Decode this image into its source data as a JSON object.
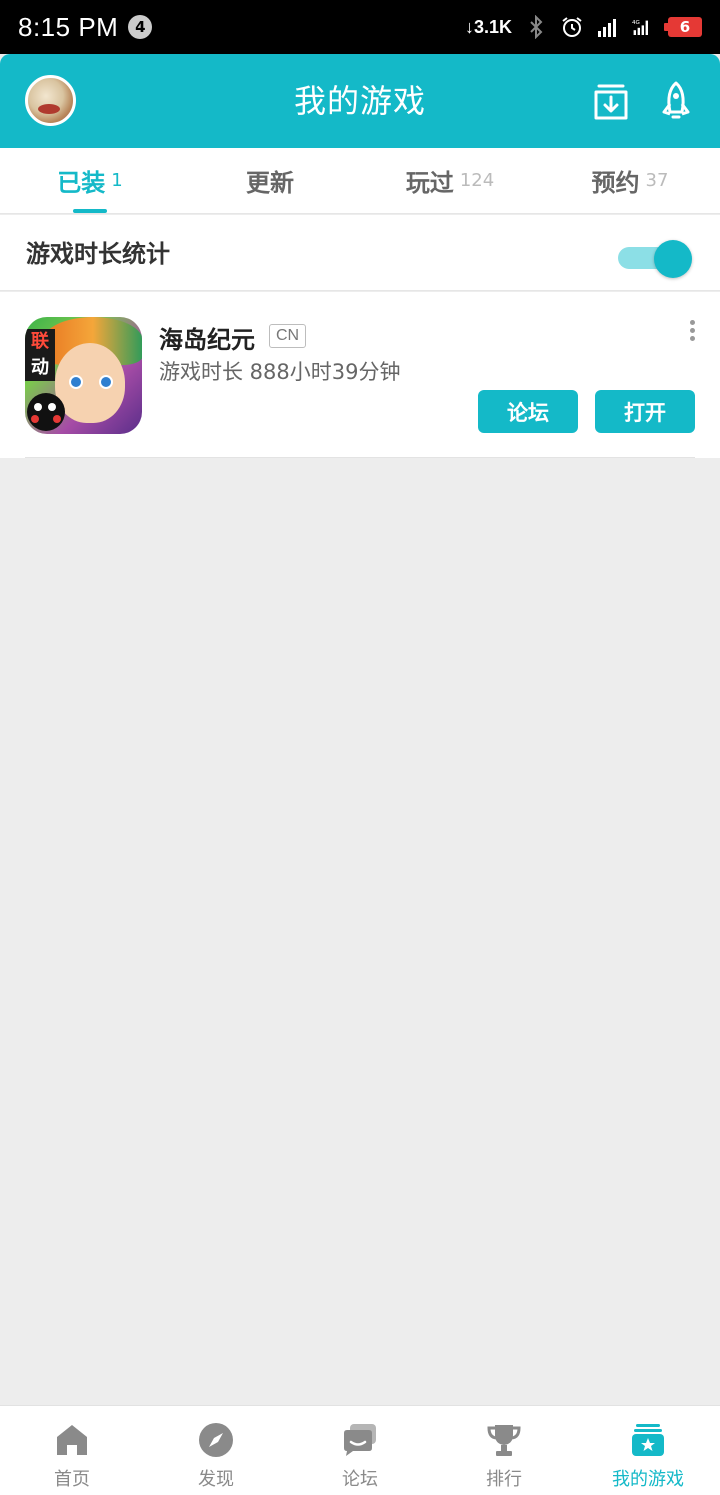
{
  "status_bar": {
    "time": "8:15 PM",
    "notification_count": "4",
    "net_speed": "3.1K",
    "battery": "6"
  },
  "header": {
    "title": "我的游戏"
  },
  "tabs": [
    {
      "label": "已装",
      "count": "1",
      "active": true
    },
    {
      "label": "更新",
      "count": "",
      "active": false
    },
    {
      "label": "玩过",
      "count": "124",
      "active": false
    },
    {
      "label": "预约",
      "count": "37",
      "active": false
    }
  ],
  "stats": {
    "label": "游戏时长统计",
    "enabled": true
  },
  "games": [
    {
      "name": "海岛纪元",
      "region": "CN",
      "playtime": "游戏时长 888小时39分钟",
      "forum_label": "论坛",
      "open_label": "打开",
      "icon_tag_top": "联",
      "icon_tag_bottom": "动"
    }
  ],
  "bottom_nav": [
    {
      "label": "首页",
      "icon": "home-icon",
      "active": false
    },
    {
      "label": "发现",
      "icon": "compass-icon",
      "active": false
    },
    {
      "label": "论坛",
      "icon": "forum-icon",
      "active": false
    },
    {
      "label": "排行",
      "icon": "trophy-icon",
      "active": false
    },
    {
      "label": "我的游戏",
      "icon": "my-games-icon",
      "active": true
    }
  ],
  "colors": {
    "accent": "#14b9c8",
    "toggle_track": "#8cdfe6",
    "background": "#ededed"
  }
}
